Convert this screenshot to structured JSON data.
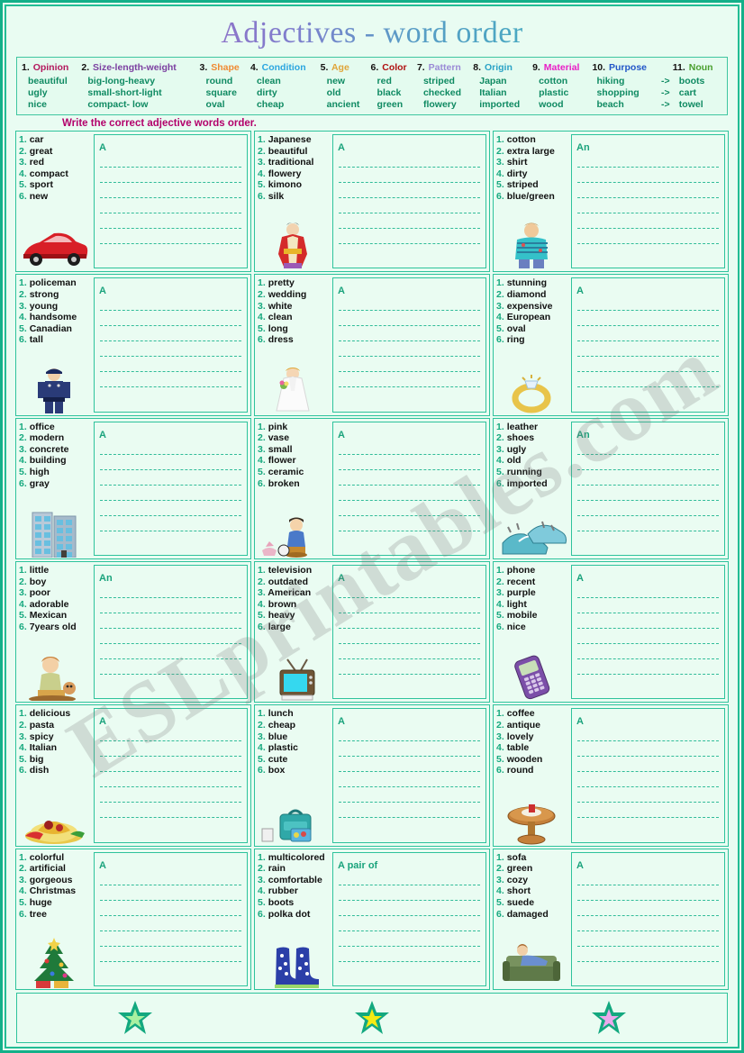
{
  "title": "Adjectives - word order",
  "instruction": "Write the correct adjective words order.",
  "legend": {
    "categories": [
      {
        "num": "1.",
        "name": "Opinion",
        "color": "#b3175c",
        "words": [
          "beautiful",
          "ugly",
          "nice"
        ]
      },
      {
        "num": "2.",
        "name": "Size-length-weight",
        "color": "#7b3fa0",
        "words": [
          "big-long-heavy",
          "small-short-light",
          "compact- low"
        ]
      },
      {
        "num": "3.",
        "name": "Shape",
        "color": "#f08a33",
        "words": [
          "round",
          "square",
          "oval"
        ]
      },
      {
        "num": "4.",
        "name": "Condition",
        "color": "#2ba6e0",
        "words": [
          "clean",
          "dirty",
          "cheap"
        ]
      },
      {
        "num": "5.",
        "name": "Age",
        "color": "#e0a53a",
        "words": [
          "new",
          "old",
          "ancient"
        ]
      },
      {
        "num": "6.",
        "name": "Color",
        "color": "#b01010",
        "words": [
          "red",
          "black",
          "green"
        ]
      },
      {
        "num": "7.",
        "name": "Pattern",
        "color": "#9a8ad6",
        "words": [
          "striped",
          "checked",
          "flowery"
        ]
      },
      {
        "num": "8.",
        "name": "Origin",
        "color": "#2aa3c6",
        "words": [
          "Japan",
          "Italian",
          "imported"
        ]
      },
      {
        "num": "9.",
        "name": "Material",
        "color": "#e91ec6",
        "words": [
          "cotton",
          "plastic",
          "wood"
        ]
      },
      {
        "num": "10.",
        "name": "Purpose",
        "color": "#2256c8",
        "words": [
          "hiking",
          "shopping",
          "beach"
        ]
      },
      {
        "num": "11.",
        "name": "Noun",
        "color": "#4a9f2e",
        "words": [
          "boots",
          "cart",
          "towel"
        ]
      }
    ],
    "arrows": [
      "->",
      "->",
      "->"
    ]
  },
  "exercises": [
    {
      "id": 1,
      "icon": "red-sports-car-icon",
      "prefix": "A",
      "words": [
        "car",
        "great",
        "red",
        "compact",
        "sport",
        "new"
      ]
    },
    {
      "id": 2,
      "icon": "japanese-kimono-icon",
      "prefix": "A",
      "words": [
        "Japanese",
        "beautiful",
        "traditional",
        "flowery",
        "kimono",
        "silk"
      ]
    },
    {
      "id": 3,
      "icon": "striped-shirt-man-icon",
      "prefix": "An",
      "words": [
        "cotton",
        "extra large",
        "shirt",
        "dirty",
        "striped",
        "blue/green"
      ]
    },
    {
      "id": 4,
      "icon": "policeman-icon",
      "prefix": "A",
      "words": [
        "policeman",
        "strong",
        "young",
        "handsome",
        "Canadian",
        "tall"
      ]
    },
    {
      "id": 5,
      "icon": "bride-dress-icon",
      "prefix": "A",
      "words": [
        "pretty",
        "wedding",
        "white",
        "clean",
        "long",
        "dress"
      ]
    },
    {
      "id": 6,
      "icon": "diamond-ring-icon",
      "prefix": "A",
      "words": [
        "stunning",
        "diamond",
        "expensive",
        "European",
        "oval",
        "ring"
      ]
    },
    {
      "id": 7,
      "icon": "office-building-icon",
      "prefix": "A",
      "words": [
        "office",
        "modern",
        "concrete",
        "building",
        "high",
        "gray"
      ]
    },
    {
      "id": 8,
      "icon": "broken-vase-boy-icon",
      "prefix": "A",
      "words": [
        "pink",
        "vase",
        "small",
        "flower",
        "ceramic",
        "broken"
      ]
    },
    {
      "id": 9,
      "icon": "running-shoes-icon",
      "prefix": "An",
      "words": [
        "leather",
        "shoes",
        "ugly",
        "old",
        "running",
        "imported"
      ]
    },
    {
      "id": 10,
      "icon": "little-boy-icon",
      "prefix": "An",
      "words": [
        "little",
        "boy",
        "poor",
        "adorable",
        "Mexican",
        "7years old"
      ]
    },
    {
      "id": 11,
      "icon": "old-television-icon",
      "prefix": "A",
      "words": [
        "television",
        "outdated",
        "American",
        "brown",
        "heavy",
        "large"
      ]
    },
    {
      "id": 12,
      "icon": "mobile-phone-icon",
      "prefix": "A",
      "words": [
        "phone",
        "recent",
        "purple",
        "light",
        "mobile",
        "nice"
      ]
    },
    {
      "id": 13,
      "icon": "pasta-dish-icon",
      "prefix": "A",
      "words": [
        "delicious",
        "pasta",
        "spicy",
        "Italian",
        "big",
        "dish"
      ]
    },
    {
      "id": 14,
      "icon": "lunch-box-icon",
      "prefix": "A",
      "words": [
        "lunch",
        "cheap",
        "blue",
        "plastic",
        "cute",
        "box"
      ]
    },
    {
      "id": 15,
      "icon": "coffee-table-icon",
      "prefix": "A",
      "words": [
        "coffee",
        "antique",
        "lovely",
        "table",
        "wooden",
        "round"
      ]
    },
    {
      "id": 16,
      "icon": "christmas-tree-icon",
      "prefix": "A",
      "words": [
        "colorful",
        "artificial",
        "gorgeous",
        "Christmas",
        "huge",
        "tree"
      ]
    },
    {
      "id": 17,
      "icon": "rain-boots-icon",
      "prefix": "A pair of",
      "words": [
        "multicolored",
        "rain",
        "comfortable",
        "rubber",
        "boots",
        "polka dot"
      ]
    },
    {
      "id": 18,
      "icon": "green-sofa-icon",
      "prefix": "A",
      "words": [
        "sofa",
        "green",
        "cozy",
        "short",
        "suede",
        "damaged"
      ]
    }
  ],
  "footer": {
    "stars": [
      {
        "name": "star-green",
        "outer": "#13a87f",
        "inner": "#a8f0a0"
      },
      {
        "name": "star-yellow",
        "outer": "#13a87f",
        "inner": "#f6ea14"
      },
      {
        "name": "star-pink",
        "outer": "#13a87f",
        "inner": "#eca8ec"
      }
    ]
  },
  "watermark": {
    "text": "ESLprintables.com"
  },
  "colors": {
    "border": "#2ec39c",
    "background": "#e9fcf2",
    "word_number": "#17a97f",
    "legend_word": "#0f8a62",
    "prefix": "#1aa37c",
    "instruction": "#b3006b"
  }
}
